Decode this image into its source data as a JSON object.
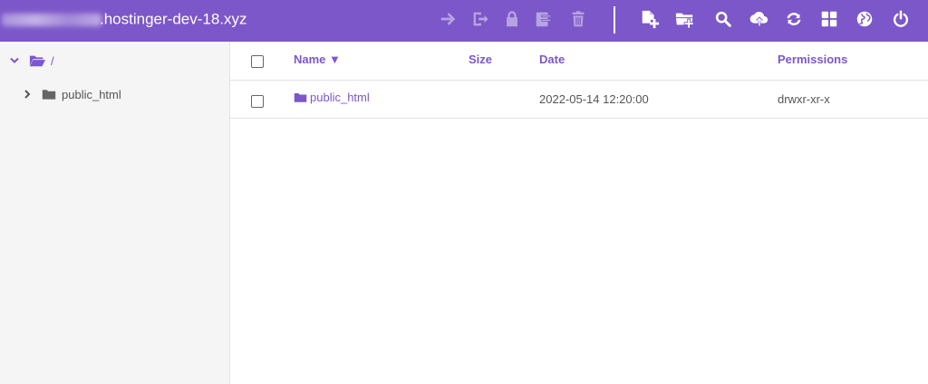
{
  "header": {
    "host_blurred": "·",
    "host_suffix": ".hostinger-dev-18.xyz",
    "bg_color": "#7c57c9",
    "toolbar_icons": [
      {
        "name": "move-arrow-icon",
        "enabled": false
      },
      {
        "name": "exit-icon",
        "enabled": false
      },
      {
        "name": "lock-icon",
        "enabled": false
      },
      {
        "name": "archive-icon",
        "enabled": false
      },
      {
        "name": "trash-icon",
        "enabled": false
      },
      {
        "name": "new-file-icon",
        "enabled": true
      },
      {
        "name": "new-folder-icon",
        "enabled": true
      },
      {
        "name": "search-icon",
        "enabled": true
      },
      {
        "name": "upload-icon",
        "enabled": true
      },
      {
        "name": "refresh-icon",
        "enabled": true
      },
      {
        "name": "grid-view-icon",
        "enabled": true
      },
      {
        "name": "globe-icon",
        "enabled": true
      },
      {
        "name": "power-icon",
        "enabled": true
      }
    ]
  },
  "sidebar": {
    "root_label": "/",
    "items": [
      {
        "label": "public_html"
      }
    ]
  },
  "table": {
    "columns": {
      "name": "Name ▼",
      "size": "Size",
      "date": "Date",
      "permissions": "Permissions"
    },
    "rows": [
      {
        "name": "public_html",
        "size": "",
        "date": "2022-05-14 12:20:00",
        "permissions": "drwxr-xr-x"
      }
    ]
  }
}
